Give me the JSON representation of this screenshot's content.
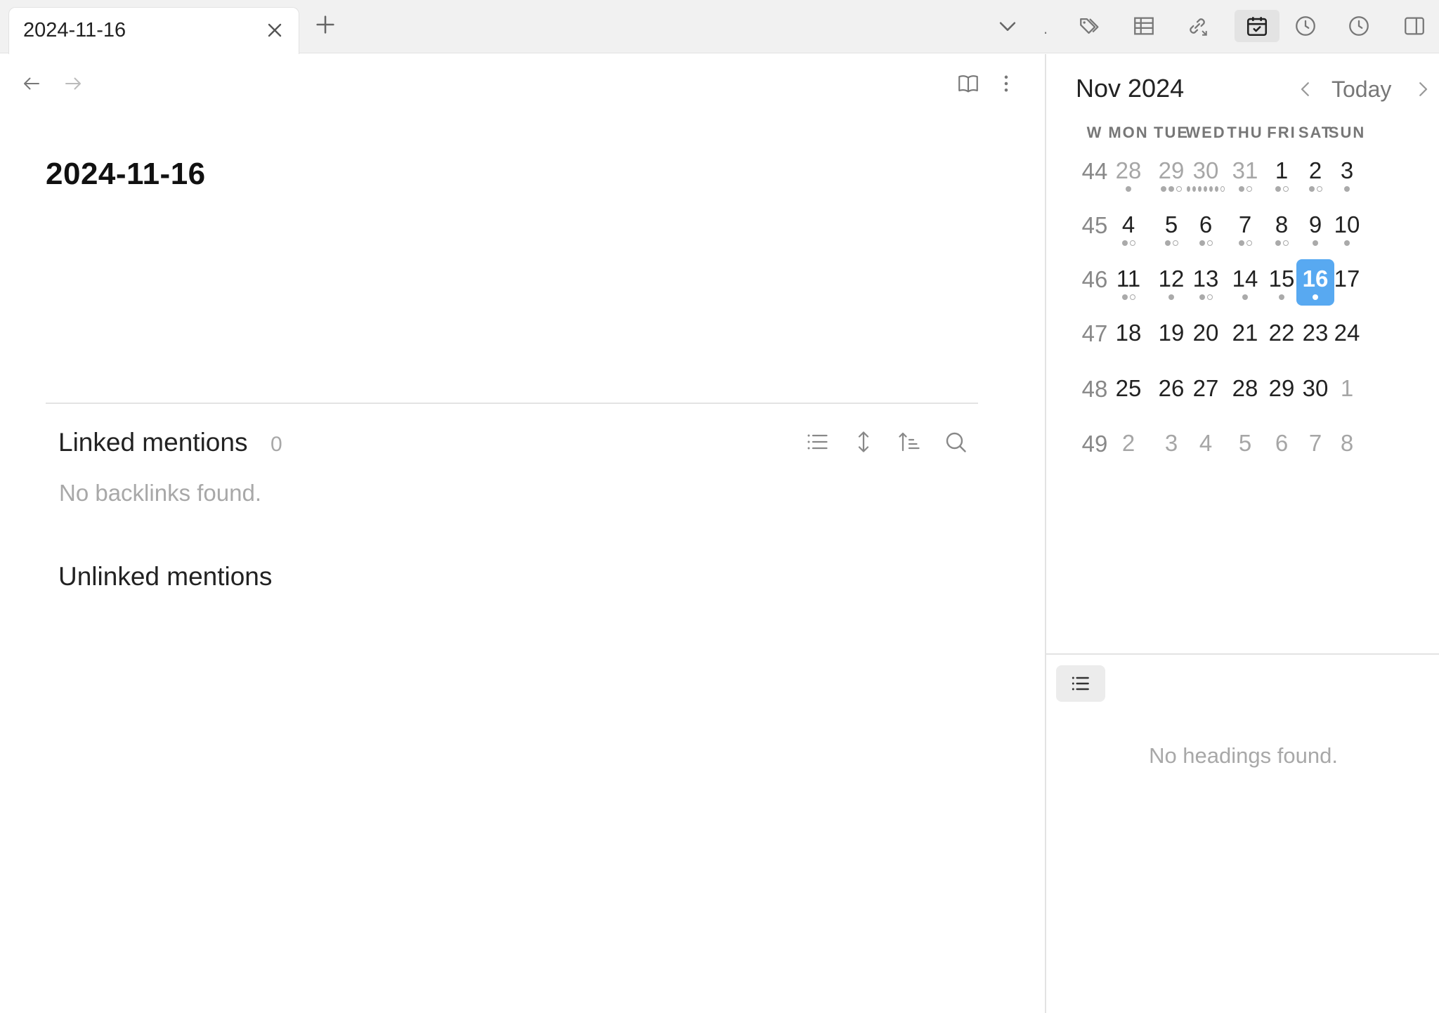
{
  "tab": {
    "title": "2024-11-16"
  },
  "toolbar": {
    "dot_label": "."
  },
  "note": {
    "title": "2024-11-16"
  },
  "backlinks": {
    "linked_title": "Linked mentions",
    "linked_count": "0",
    "no_backlinks": "No backlinks found.",
    "unlinked_title": "Unlinked mentions"
  },
  "calendar": {
    "month_label": "Nov 2024",
    "today_label": "Today",
    "headers": [
      "W",
      "MON",
      "TUE",
      "WED",
      "THU",
      "FRI",
      "SAT",
      "SUN"
    ],
    "weeks": [
      {
        "num": "44",
        "days": [
          {
            "d": "28",
            "other": true,
            "dots": "f"
          },
          {
            "d": "29",
            "other": true,
            "dots": "ffo"
          },
          {
            "d": "30",
            "other": true,
            "dots": "ffffffo"
          },
          {
            "d": "31",
            "other": true,
            "dots": "fo"
          },
          {
            "d": "1",
            "dots": "fo"
          },
          {
            "d": "2",
            "dots": "fo"
          },
          {
            "d": "3",
            "dots": "f"
          }
        ]
      },
      {
        "num": "45",
        "days": [
          {
            "d": "4",
            "dots": "fo"
          },
          {
            "d": "5",
            "dots": "fo"
          },
          {
            "d": "6",
            "dots": "fo"
          },
          {
            "d": "7",
            "dots": "fo"
          },
          {
            "d": "8",
            "dots": "fo"
          },
          {
            "d": "9",
            "dots": "f"
          },
          {
            "d": "10",
            "dots": "f"
          }
        ]
      },
      {
        "num": "46",
        "days": [
          {
            "d": "11",
            "dots": "fo"
          },
          {
            "d": "12",
            "dots": "f"
          },
          {
            "d": "13",
            "dots": "fo"
          },
          {
            "d": "14",
            "dots": "f"
          },
          {
            "d": "15",
            "dots": "f"
          },
          {
            "d": "16",
            "today": true,
            "dots": "f"
          },
          {
            "d": "17",
            "dots": ""
          }
        ]
      },
      {
        "num": "47",
        "days": [
          {
            "d": "18"
          },
          {
            "d": "19"
          },
          {
            "d": "20"
          },
          {
            "d": "21"
          },
          {
            "d": "22"
          },
          {
            "d": "23"
          },
          {
            "d": "24"
          }
        ]
      },
      {
        "num": "48",
        "days": [
          {
            "d": "25"
          },
          {
            "d": "26"
          },
          {
            "d": "27"
          },
          {
            "d": "28"
          },
          {
            "d": "29"
          },
          {
            "d": "30"
          },
          {
            "d": "1",
            "other": true
          }
        ]
      },
      {
        "num": "49",
        "days": [
          {
            "d": "2",
            "other": true
          },
          {
            "d": "3",
            "other": true
          },
          {
            "d": "4",
            "other": true
          },
          {
            "d": "5",
            "other": true
          },
          {
            "d": "6",
            "other": true
          },
          {
            "d": "7",
            "other": true
          },
          {
            "d": "8",
            "other": true
          }
        ]
      }
    ]
  },
  "outline": {
    "empty_text": "No headings found."
  },
  "colors": {
    "accent": "#58a9f1",
    "muted": "#a8a8a8",
    "tabbar": "#f1f1f1"
  }
}
